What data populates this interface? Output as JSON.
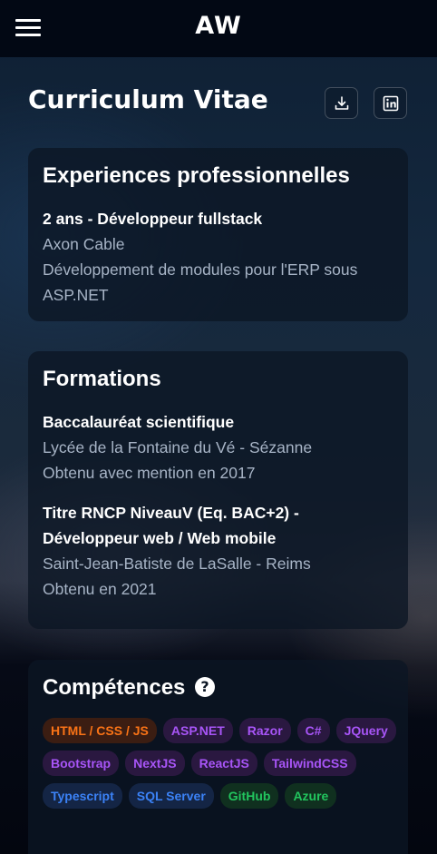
{
  "header": {
    "logo": "AW"
  },
  "page": {
    "title": "Curriculum Vitae"
  },
  "experiences": {
    "title": "Experiences professionnelles",
    "items": [
      {
        "title": "2 ans - Développeur fullstack",
        "company": "Axon Cable",
        "description": "Développement de modules pour l'ERP sous ASP.NET"
      }
    ]
  },
  "formations": {
    "title": "Formations",
    "items": [
      {
        "title": "Baccalauréat scientifique",
        "school": "Lycée de la Fontaine du Vé - Sézanne",
        "detail": "Obtenu avec mention en 2017"
      },
      {
        "title": "Titre RNCP NiveauV (Eq. BAC+2) - Développeur web / Web mobile",
        "school": "Saint-Jean-Batiste de LaSalle - Reims",
        "detail": "Obtenu en 2021"
      }
    ]
  },
  "skills": {
    "title": "Compétences",
    "help_glyph": "?",
    "badges": [
      {
        "label": "HTML / CSS / JS",
        "color": "#f97316",
        "bg": "#3b1d12"
      },
      {
        "label": "ASP.NET",
        "color": "#a855f7",
        "bg": "#2a1840"
      },
      {
        "label": "Razor",
        "color": "#a855f7",
        "bg": "#2a1840"
      },
      {
        "label": "C#",
        "color": "#a855f7",
        "bg": "#2a1840"
      },
      {
        "label": "JQuery",
        "color": "#a855f7",
        "bg": "#2a1840"
      },
      {
        "label": "Bootstrap",
        "color": "#a855f7",
        "bg": "#2a1840"
      },
      {
        "label": "NextJS",
        "color": "#a855f7",
        "bg": "#2a1840"
      },
      {
        "label": "ReactJS",
        "color": "#a855f7",
        "bg": "#2a1840"
      },
      {
        "label": "TailwindCSS",
        "color": "#a855f7",
        "bg": "#2a1840"
      },
      {
        "label": "Typescript",
        "color": "#3b82f6",
        "bg": "#142545"
      },
      {
        "label": "SQL Server",
        "color": "#3b82f6",
        "bg": "#142545"
      },
      {
        "label": "GitHub",
        "color": "#22c55e",
        "bg": "#10301f"
      },
      {
        "label": "Azure",
        "color": "#22c55e",
        "bg": "#10301f"
      }
    ]
  },
  "icons": {
    "menu": "menu-icon",
    "download": "download-icon",
    "linkedin": "linkedin-icon",
    "help": "question-circle-icon"
  }
}
